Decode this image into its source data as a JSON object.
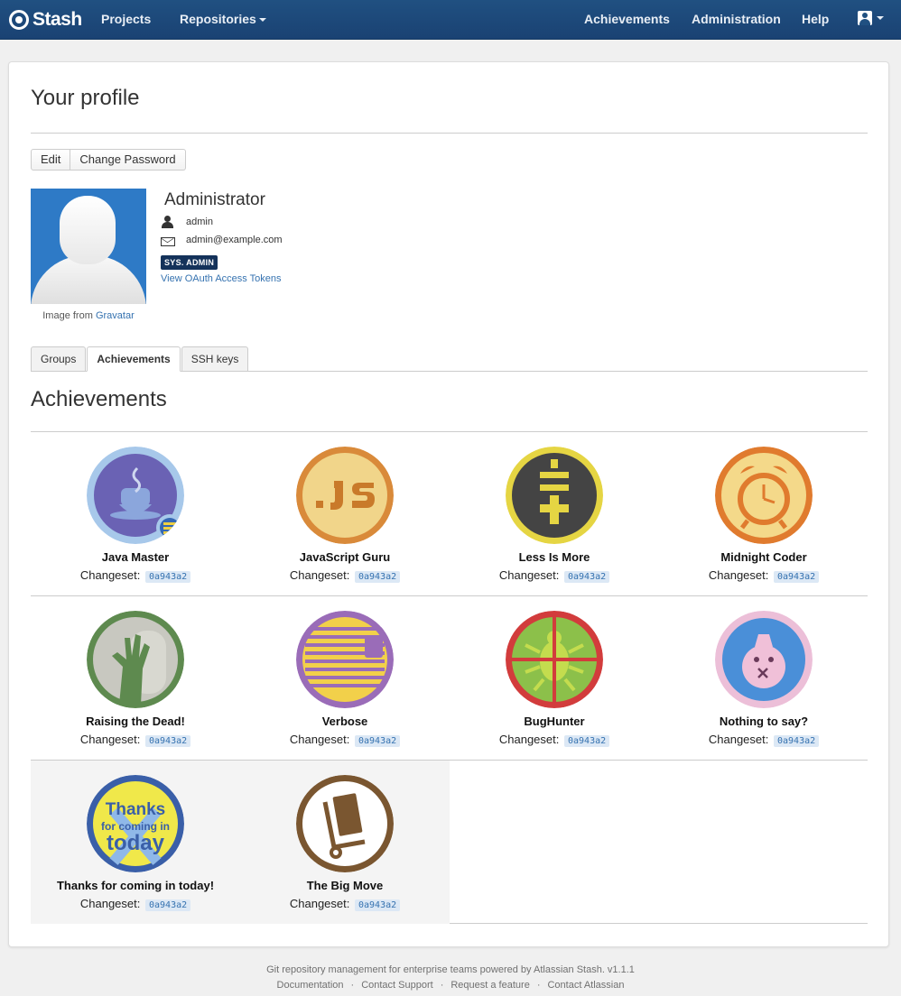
{
  "header": {
    "brand": "Stash",
    "nav": {
      "projects": "Projects",
      "repositories": "Repositories",
      "achievements": "Achievements",
      "administration": "Administration",
      "help": "Help"
    }
  },
  "page": {
    "title": "Your profile"
  },
  "actions": {
    "edit": "Edit",
    "change_password": "Change Password"
  },
  "profile": {
    "display_name": "Administrator",
    "username": "admin",
    "email": "admin@example.com",
    "role_badge": "SYS. ADMIN",
    "oauth_link": "View OAuth Access Tokens",
    "gravatar_prefix": "Image from",
    "gravatar_link": "Gravatar"
  },
  "tabs": [
    "Groups",
    "Achievements",
    "SSH keys"
  ],
  "section_title": "Achievements",
  "changeset_label": "Changeset:",
  "achievements": [
    {
      "name": "Java Master",
      "changeset": "0a943a2",
      "icon": "java-coffee-icon"
    },
    {
      "name": "JavaScript Guru",
      "changeset": "0a943a2",
      "icon": "js-icon"
    },
    {
      "name": "Less Is More",
      "changeset": "0a943a2",
      "icon": "plus-minus-icon"
    },
    {
      "name": "Midnight Coder",
      "changeset": "0a943a2",
      "icon": "alarm-clock-icon"
    },
    {
      "name": "Raising the Dead!",
      "changeset": "0a943a2",
      "icon": "zombie-hand-icon"
    },
    {
      "name": "Verbose",
      "changeset": "0a943a2",
      "icon": "verbose-lines-icon"
    },
    {
      "name": "BugHunter",
      "changeset": "0a943a2",
      "icon": "bug-crosshair-icon"
    },
    {
      "name": "Nothing to say?",
      "changeset": "0a943a2",
      "icon": "pig-face-icon"
    },
    {
      "name": "Thanks for coming in today!",
      "changeset": "0a943a2",
      "icon": "thanks-text-icon",
      "badge_text": [
        "Thanks",
        "for coming in",
        "today"
      ]
    },
    {
      "name": "The Big Move",
      "changeset": "0a943a2",
      "icon": "hand-truck-icon"
    }
  ],
  "footer": {
    "tagline": "Git repository management for enterprise teams powered by Atlassian Stash. v1.1.1",
    "links": [
      "Documentation",
      "Contact Support",
      "Request a feature",
      "Contact Atlassian"
    ]
  },
  "colors": {
    "header": "#205081",
    "link": "#3572b0",
    "badge_bg": "#14325a"
  }
}
